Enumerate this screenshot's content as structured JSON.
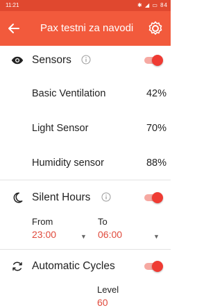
{
  "status_bar": {
    "time": "11:21",
    "icons": "✱ ◢ ▭ 84"
  },
  "app_bar": {
    "title": "Pax testni za navodi",
    "back_icon": "arrow-back-icon",
    "settings_icon": "gear-icon"
  },
  "sensors": {
    "label": "Sensors",
    "enabled": true,
    "items": [
      {
        "name": "Basic Ventilation",
        "value": "42%"
      },
      {
        "name": "Light Sensor",
        "value": "70%"
      },
      {
        "name": "Humidity sensor",
        "value": "88%"
      }
    ]
  },
  "silent_hours": {
    "label": "Silent Hours",
    "enabled": true,
    "from_label": "From",
    "from_value": "23:00",
    "to_label": "To",
    "to_value": "06:00"
  },
  "automatic_cycles": {
    "label": "Automatic Cycles",
    "enabled": true,
    "level_label": "Level",
    "level_value": "60"
  },
  "colors": {
    "accent": "#f25a3c",
    "status_bar": "#e0482f",
    "toggle_on": "#ef3b33",
    "value_text": "#e04a3c"
  }
}
